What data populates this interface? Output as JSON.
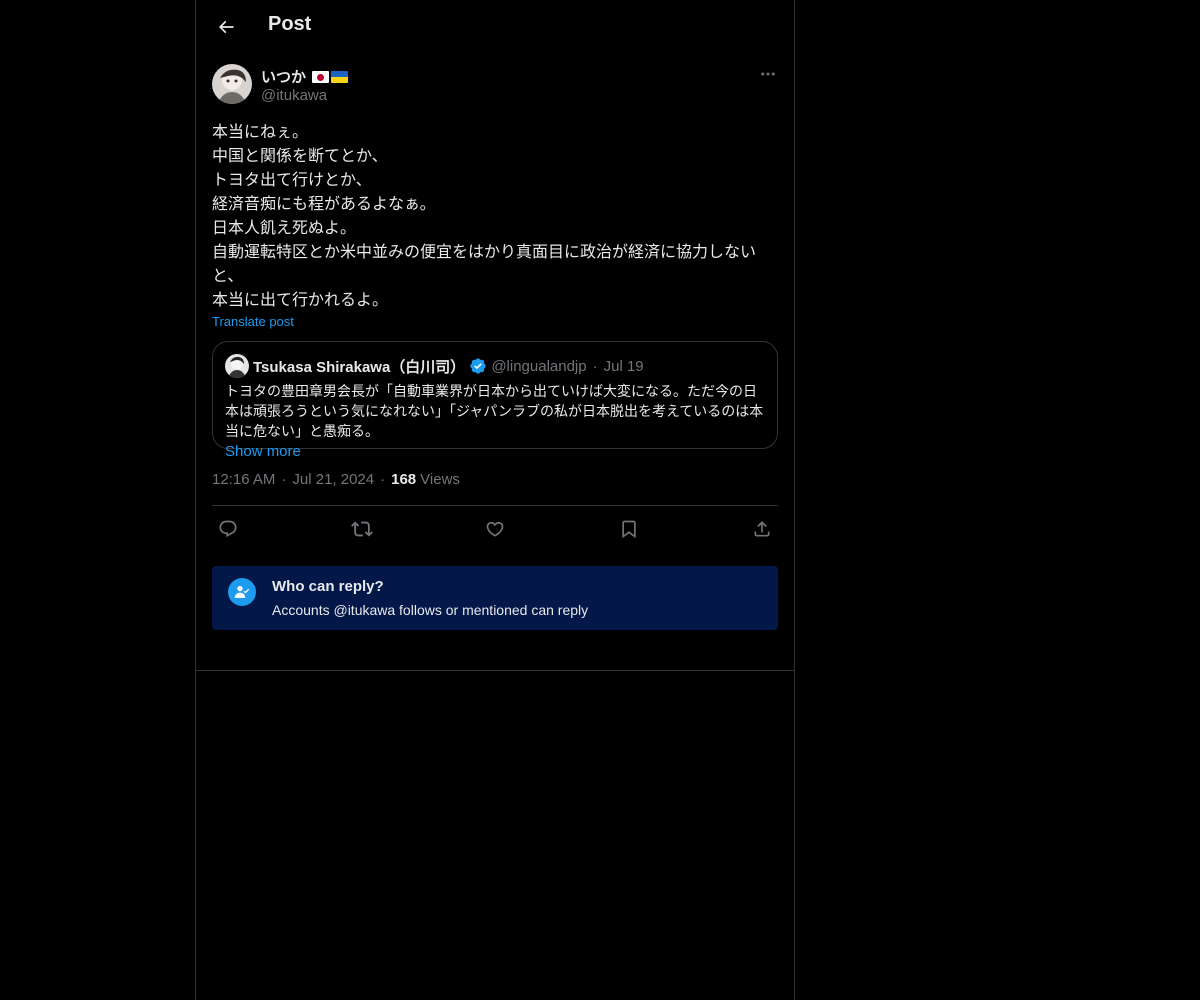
{
  "header": {
    "title": "Post"
  },
  "post": {
    "author_name": "いつか",
    "author_handle": "@itukawa",
    "text": "本当にねぇ。\n中国と関係を断てとか、\nトヨタ出て行けとか、\n経済音痴にも程があるよなぁ。\n日本人飢え死ぬよ。\n自動運転特区とか米中並みの便宜をはかり真面目に政治が経済に協力しないと、\n本当に出て行かれるよ。",
    "translate_label": "Translate post",
    "timestamp_time": "12:16 AM",
    "timestamp_date": "Jul 21, 2024",
    "views_count": "168",
    "views_label": "Views"
  },
  "quote": {
    "name": "Tsukasa Shirakawa（白川司）",
    "handle": "@lingualandjp",
    "date": "Jul 19",
    "text": "トヨタの豊田章男会長が「自動車業界が日本から出ていけば大変になる。ただ今の日本は頑張ろうという気になれない」「ジャパンラブの私が日本脱出を考えているのは本当に危ない」と愚痴る。",
    "show_more": "Show more"
  },
  "reply_notice": {
    "title": "Who can reply?",
    "subtitle": "Accounts @itukawa follows or mentioned can reply"
  },
  "colors": {
    "background": "#000000",
    "text": "#e7e9ea",
    "muted": "#71767b",
    "accent": "#1d9bf0",
    "border": "#2f3336",
    "reply_box": "#031849"
  },
  "icons": {
    "back": "arrow-left-icon",
    "more": "more-dots-icon",
    "reply": "reply-icon",
    "repost": "repost-icon",
    "like": "heart-icon",
    "bookmark": "bookmark-icon",
    "share": "share-icon",
    "verified": "verified-badge-icon",
    "who_can_reply": "person-check-icon"
  }
}
